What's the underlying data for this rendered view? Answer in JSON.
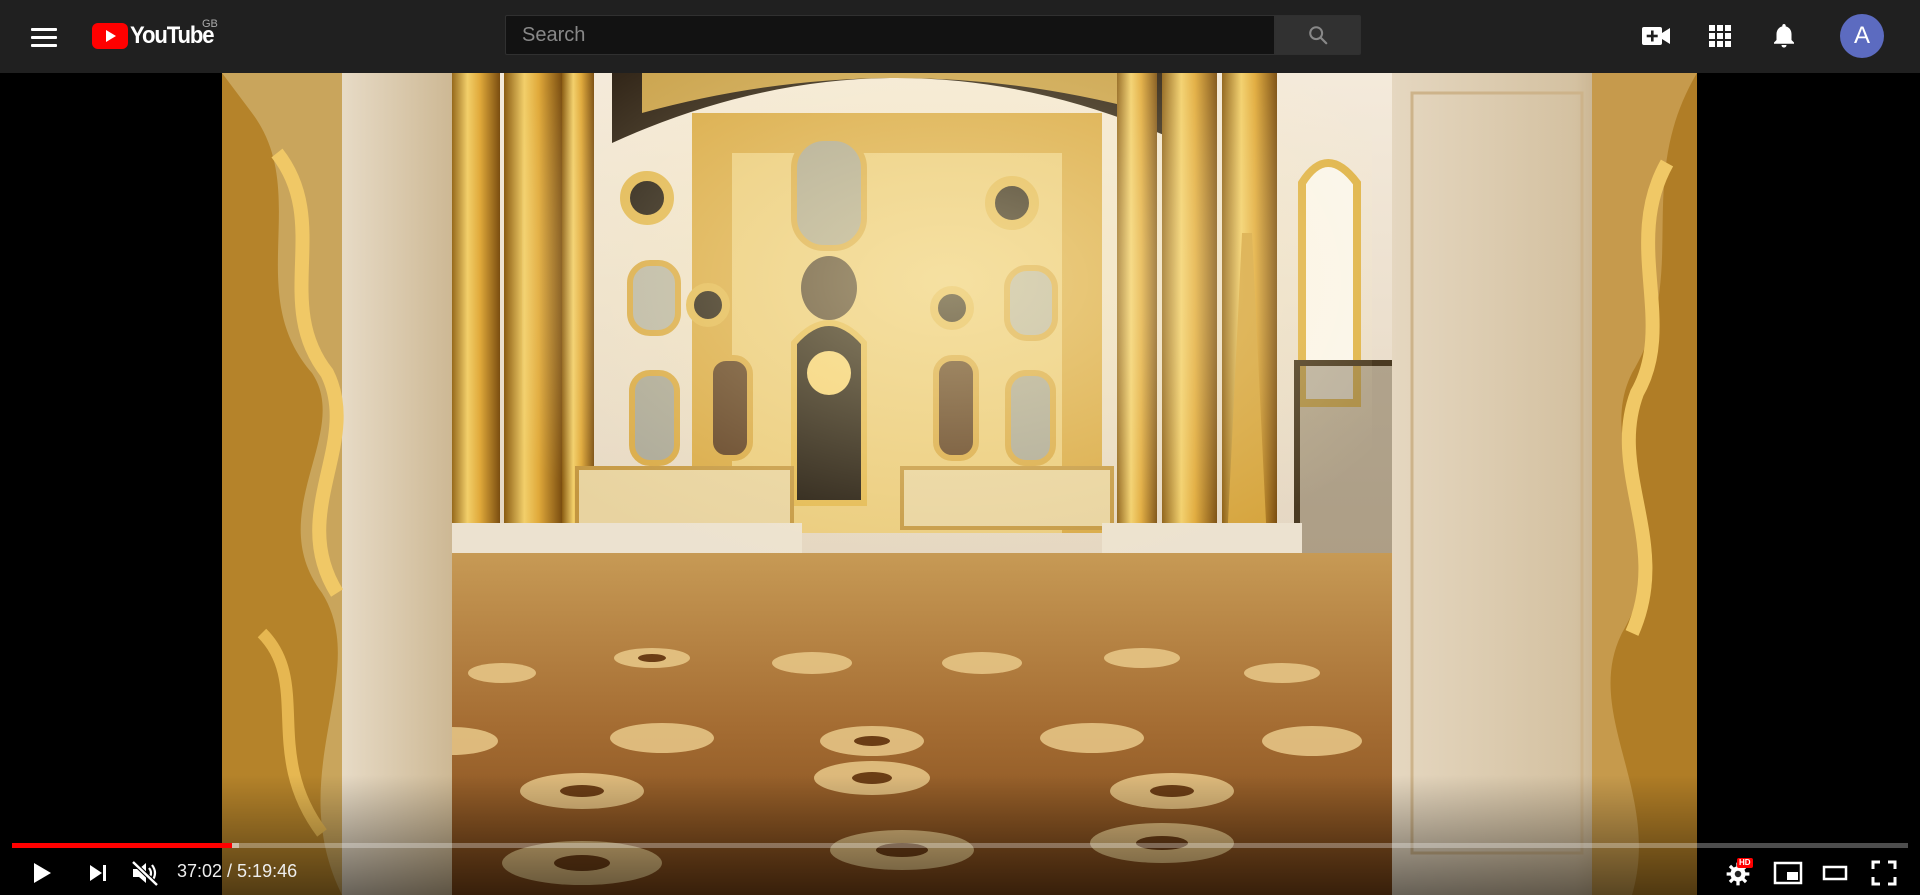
{
  "masthead": {
    "logo_text": "YouTube",
    "country_code": "GB",
    "search_placeholder": "Search",
    "avatar_letter": "A"
  },
  "icons": {
    "menu": "menu-icon",
    "search": "search-icon",
    "create": "create-video-icon",
    "apps": "apps-grid-icon",
    "notifications": "bell-icon",
    "play": "play-icon",
    "next": "next-icon",
    "mute": "volume-muted-icon",
    "settings": "settings-icon",
    "miniplayer": "miniplayer-icon",
    "theater": "theater-mode-icon",
    "fullscreen": "fullscreen-icon"
  },
  "player": {
    "current_time": "37:02",
    "duration": "5:19:46",
    "time_display": "37:02 / 5:19:46",
    "played_fraction": 0.1158,
    "quality_badge": "HD"
  },
  "colors": {
    "masthead_bg": "#202020",
    "brand_red": "#ff0000",
    "avatar_bg": "#5c6bc0"
  }
}
